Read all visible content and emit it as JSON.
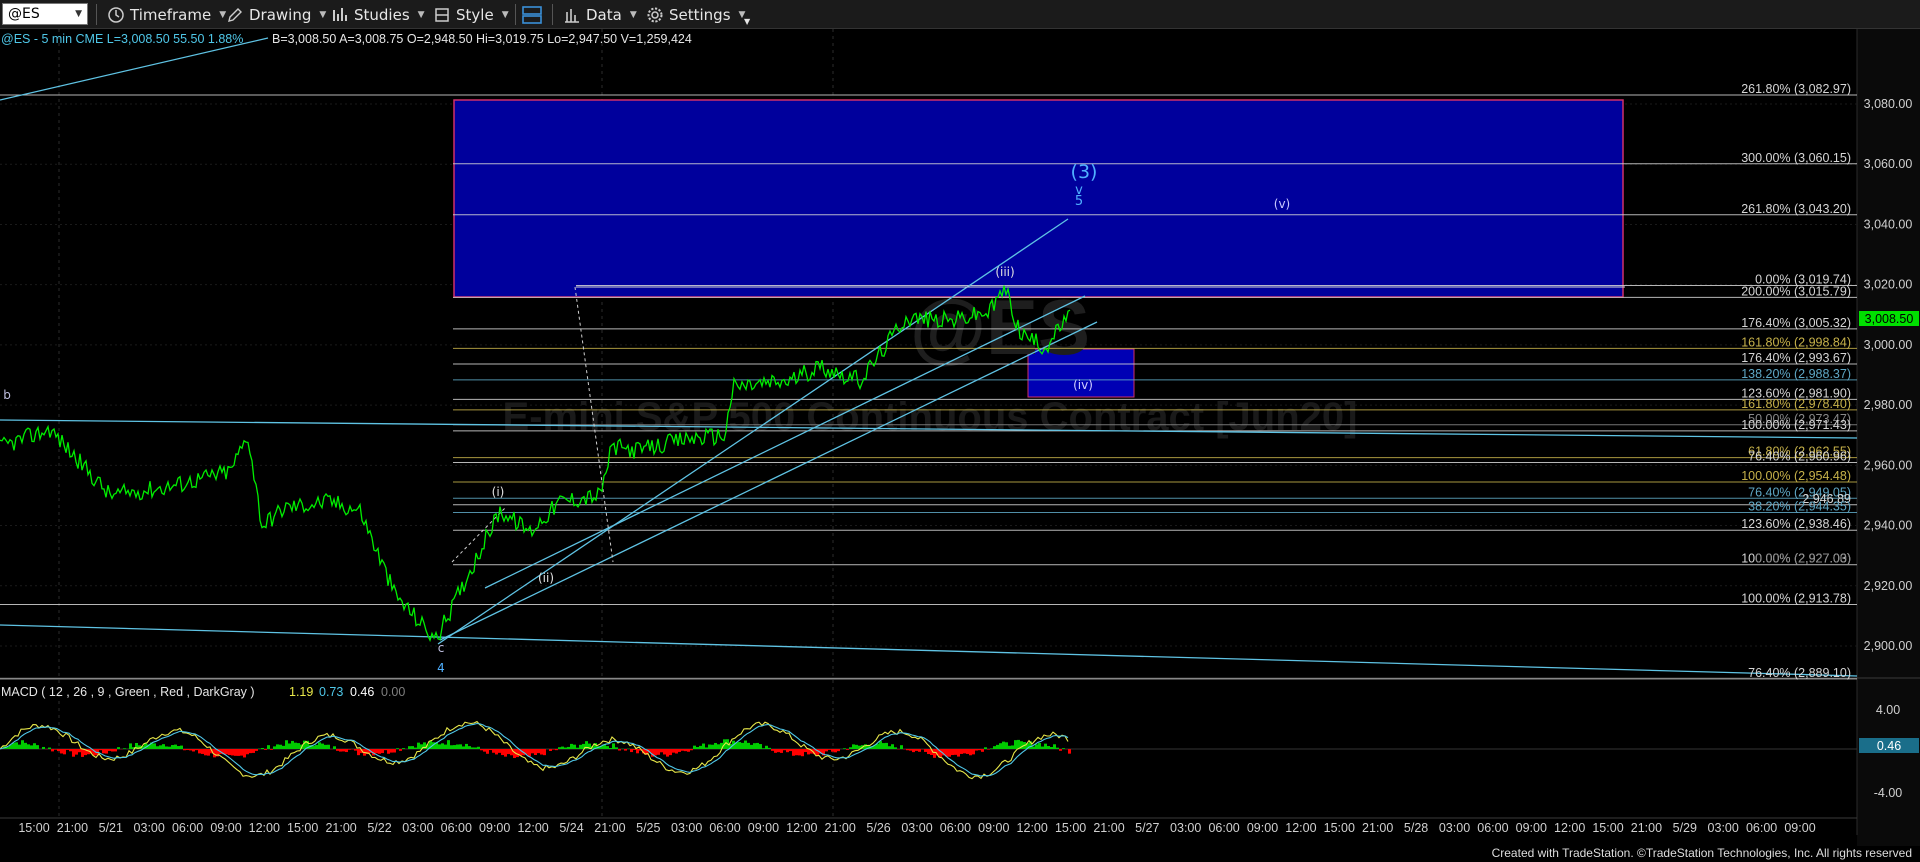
{
  "toolbar": {
    "symbol": "@ES",
    "items": [
      "Timeframe",
      "Drawing",
      "Studies",
      "Style",
      "",
      "Data",
      "Settings"
    ]
  },
  "header": {
    "symbol_line": "@ES - 5 min  CME  L=3,008.50  55.50  1.88%",
    "stats": "B=3,008.50  A=3,008.75  O=2,948.50  Hi=3,019.75  Lo=2,947.50  V=1,259,424"
  },
  "watermark": {
    "symbol": "@ES",
    "description": "E-mini S&P 500 Continuous Contract [Jun20]"
  },
  "price_axis": {
    "ticks": [
      "3,080.00",
      "3,060.00",
      "3,040.00",
      "3,020.00",
      "3,000.00",
      "2,980.00",
      "2,960.00",
      "2,940.00",
      "2,920.00",
      "2,900.00"
    ],
    "last_price": "3,008.50"
  },
  "fib_levels": [
    {
      "label": "261.80% (3,082.97)",
      "color": "#d6d6d6"
    },
    {
      "label": "300.00% (3,060.15)",
      "color": "#d6d6d6"
    },
    {
      "label": "261.80% (3,043.20)",
      "color": "#d6d6d6"
    },
    {
      "label": "0.00% (3,019.74)",
      "color": "#d6d6d6"
    },
    {
      "label": "200.00% (3,015.79)",
      "color": "#d6d6d6"
    },
    {
      "label": "176.40% (3,005.32)",
      "color": "#d6d6d6"
    },
    {
      "label": "161.80% (2,998.84)",
      "color": "#c7b24a"
    },
    {
      "label": "176.40% (2,993.67)",
      "color": "#d6d6d6"
    },
    {
      "label": "138.20% (2,988.37)",
      "color": "#5fa8c6"
    },
    {
      "label": "123.60% (2,981.90)",
      "color": "#d6d6d6"
    },
    {
      "label": "161.80% (2,978.40)",
      "color": "#c7b24a"
    },
    {
      "label": "50.00% (2,973.47)",
      "color": "#888888"
    },
    {
      "label": "100.00% (2,971.43)",
      "color": "#d6d6d6"
    },
    {
      "label": "61.80% (2,962.55)",
      "color": "#c7b24a"
    },
    {
      "label": "76.40% (2,960.96)",
      "color": "#d6d6d6"
    },
    {
      "label": "100.00% (2,954.48)",
      "color": "#c7b24a"
    },
    {
      "label": "76.40% (2,949.05)",
      "color": "#5fa8c6"
    },
    {
      "label": "2,946.89",
      "color": "#d6d6d6"
    },
    {
      "label": "38.20% (2,944.35)",
      "color": "#5fa8c6"
    },
    {
      "label": "123.60% (2,938.46)",
      "color": "#d6d6d6"
    },
    {
      "label": "100.00% (2,927.03)",
      "color": "#d6d6d6"
    },
    {
      "label": "0.00% (2,927.00)",
      "color": "#888888"
    },
    {
      "label": "100.00% (2,913.78)",
      "color": "#d6d6d6"
    },
    {
      "label": "76.40% (2,889.10)",
      "color": "#d6d6d6"
    }
  ],
  "wave_labels": {
    "wave3": "(3)",
    "wave3_v": "v",
    "wave3_5": "5",
    "wave_v": "(v)",
    "wave_iii": "(iii)",
    "wave_iv": "(iv)",
    "wave_i": "(i)",
    "wave_ii": "(ii)",
    "wave_b": "b",
    "wave_c": "c",
    "wave_4": "4"
  },
  "macd": {
    "title": "MACD ( 12 , 26 , 9 , Green , Red , DarkGray )",
    "values": [
      "1.19",
      "0.73",
      "0.46",
      "0.00"
    ],
    "value_colors": [
      "#e8e84a",
      "#4fc7e8",
      "#ffffff",
      "#7f7f7f"
    ],
    "axis_ticks": [
      "4.00",
      "-4.00"
    ],
    "current": "0.46"
  },
  "time_axis": [
    "15:00",
    "21:00",
    "5/21",
    "03:00",
    "06:00",
    "09:00",
    "12:00",
    "15:00",
    "21:00",
    "5/22",
    "03:00",
    "06:00",
    "09:00",
    "12:00",
    "5/24",
    "21:00",
    "5/25",
    "03:00",
    "06:00",
    "09:00",
    "12:00",
    "21:00",
    "5/26",
    "03:00",
    "06:00",
    "09:00",
    "12:00",
    "15:00",
    "21:00",
    "5/27",
    "03:00",
    "06:00",
    "09:00",
    "12:00",
    "15:00",
    "21:00",
    "5/28",
    "03:00",
    "06:00",
    "09:00",
    "12:00",
    "15:00",
    "21:00",
    "5/29",
    "03:00",
    "06:00",
    "09:00"
  ],
  "footer": "Created with TradeStation. ©TradeStation Technologies, Inc. All rights reserved",
  "colors": {
    "price_line": "#00ee00",
    "channel": "#5fc3e4",
    "target_box": "#00009c",
    "target_box_border": "#d0306a",
    "macd_up": "#00cc00",
    "macd_down": "#ff0000",
    "last_price_tag": "#00e000"
  }
}
